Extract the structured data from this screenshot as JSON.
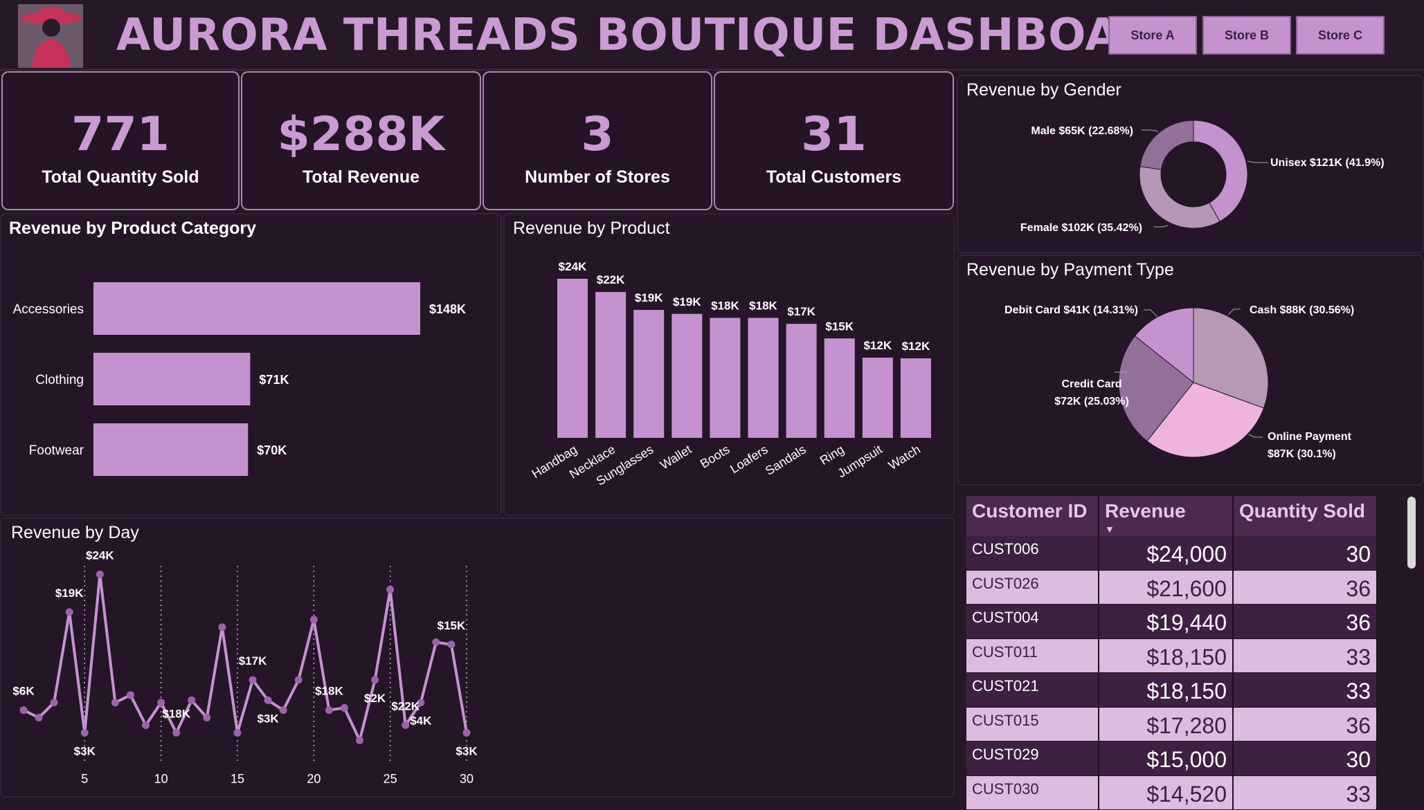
{
  "header": {
    "title": "AURORA THREADS BOUTIQUE DASHBOARD",
    "stores": [
      "Store A",
      "Store B",
      "Store C"
    ]
  },
  "kpis": [
    {
      "value": "771",
      "label": "Total Quantity Sold"
    },
    {
      "value": "$288K",
      "label": "Total Revenue"
    },
    {
      "value": "3",
      "label": "Number of Stores"
    },
    {
      "value": "31",
      "label": "Total Customers"
    }
  ],
  "colors": {
    "accent": "#c592cf",
    "background": "#261727",
    "title": "#c99bd2"
  },
  "chart_data": [
    {
      "type": "bar",
      "orientation": "horizontal",
      "title": "Revenue by Product Category",
      "categories": [
        "Accessories",
        "Clothing",
        "Footwear"
      ],
      "values": [
        148,
        71,
        70
      ],
      "data_labels": [
        "$148K",
        "$71K",
        "$70K"
      ],
      "color": "#c592cf"
    },
    {
      "type": "bar",
      "title": "Revenue by Product",
      "categories": [
        "Handbag",
        "Necklace",
        "Sunglasses",
        "Wallet",
        "Boots",
        "Loafers",
        "Sandals",
        "Ring",
        "Jumpsuit",
        "Watch"
      ],
      "values": [
        24,
        22,
        19.3,
        18.7,
        18.1,
        18.1,
        17.2,
        15,
        12.1,
        12
      ],
      "data_labels": [
        "$24K",
        "$22K",
        "$19K",
        "$19K",
        "$18K",
        "$18K",
        "$17K",
        "$15K",
        "$12K",
        "$12K"
      ],
      "color": "#c592cf"
    },
    {
      "type": "pie",
      "donut": true,
      "title": "Revenue by Gender",
      "labels": [
        "Unisex",
        "Female",
        "Male"
      ],
      "values": [
        41.9,
        35.42,
        22.68
      ],
      "data_labels": [
        "Unisex $121K (41.9%)",
        "Female $102K (35.42%)",
        "Male $65K (22.68%)"
      ],
      "colors": [
        "#c592cf",
        "#b497b5",
        "#93709a"
      ]
    },
    {
      "type": "pie",
      "title": "Revenue by Payment Type",
      "labels": [
        "Cash",
        "Online Payment",
        "Credit Card",
        "Debit Card"
      ],
      "values": [
        30.56,
        30.1,
        25.03,
        14.31
      ],
      "data_labels": [
        "Cash $88K (30.56%)",
        "Online Payment",
        "$87K (30.1%)",
        "Credit Card",
        "$72K (25.03%)",
        "Debit Card $41K (14.31%)"
      ],
      "colors": [
        "#b699b2",
        "#f0b4dc",
        "#93709a",
        "#c592cf"
      ]
    },
    {
      "type": "line",
      "title": "Revenue by Day",
      "x": [
        1,
        2,
        3,
        4,
        5,
        6,
        7,
        8,
        9,
        10,
        11,
        12,
        13,
        14,
        15,
        16,
        17,
        18,
        19,
        20,
        21,
        22,
        23,
        24,
        25,
        26,
        27,
        28,
        29,
        30,
        31
      ],
      "y": [
        6,
        5,
        7,
        19,
        3,
        24,
        7,
        8,
        4,
        7,
        3,
        7.3,
        5,
        17,
        3,
        10,
        7.3,
        6,
        10,
        18,
        6,
        6.3,
        2,
        10,
        22,
        4,
        7,
        15,
        14.7,
        3
      ],
      "xticks": [
        "5",
        "10",
        "15",
        "20",
        "25",
        "30"
      ],
      "xtick_values": [
        5,
        10,
        15,
        20,
        25,
        30
      ],
      "labelled_points": [
        [
          1,
          "$6K"
        ],
        [
          4,
          "$19K"
        ],
        [
          5,
          "$3K"
        ],
        [
          6,
          "$24K"
        ],
        [
          11,
          "$18K"
        ],
        [
          16,
          "$17K"
        ],
        [
          17,
          "$3K"
        ],
        [
          21,
          "$18K"
        ],
        [
          24,
          "$2K"
        ],
        [
          26,
          "$22K"
        ],
        [
          27,
          "$4K"
        ],
        [
          29,
          "$15K"
        ],
        [
          31,
          "$3K"
        ]
      ],
      "color": "#c592cf"
    },
    {
      "type": "table",
      "columns": [
        "Customer ID",
        "Revenue",
        "Quantity Sold"
      ],
      "rows": [
        [
          "CUST006",
          "$24,000",
          "30"
        ],
        [
          "CUST026",
          "$21,600",
          "36"
        ],
        [
          "CUST004",
          "$19,440",
          "36"
        ],
        [
          "CUST011",
          "$18,150",
          "33"
        ],
        [
          "CUST021",
          "$18,150",
          "33"
        ],
        [
          "CUST015",
          "$17,280",
          "36"
        ],
        [
          "CUST029",
          "$15,000",
          "30"
        ],
        [
          "CUST030",
          "$14,520",
          "33"
        ]
      ]
    }
  ]
}
